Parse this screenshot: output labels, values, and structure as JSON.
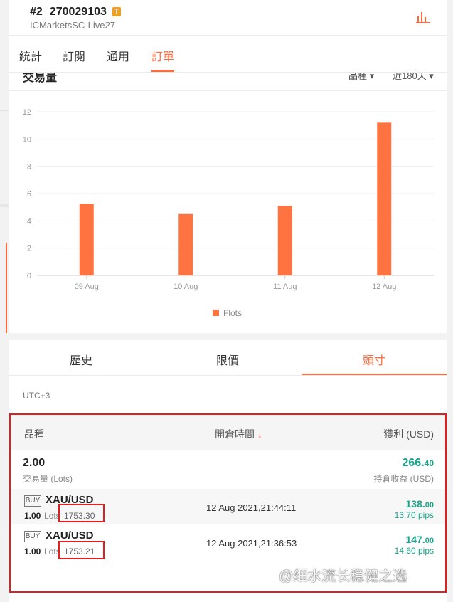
{
  "header": {
    "account_index": "#2",
    "account_number": "270029103",
    "badge": "T",
    "server": "ICMarketsSC-Live27",
    "stats_icon": "bar-chart-icon"
  },
  "tabs": [
    {
      "label": "統計"
    },
    {
      "label": "訂閱"
    },
    {
      "label": "通用"
    },
    {
      "label": "訂單"
    }
  ],
  "active_tab": "訂單",
  "chart_section": {
    "title": "交易量",
    "symbol_filter": "品種 ▾",
    "period_filter": "近180天 ▾"
  },
  "chart_data": {
    "type": "bar",
    "categories": [
      "09 Aug",
      "10 Aug",
      "11 Aug",
      "12 Aug"
    ],
    "series": [
      {
        "name": "Flots",
        "values": [
          5.25,
          4.5,
          5.1,
          11.2
        ]
      }
    ],
    "ylim": [
      0,
      12
    ],
    "yticks": [
      0,
      2,
      4,
      6,
      8,
      10,
      12
    ],
    "grid": true,
    "legend": "bottom",
    "bar_color": "#ff7340"
  },
  "subtabs": [
    {
      "label": "歷史"
    },
    {
      "label": "限價"
    },
    {
      "label": "頭寸"
    }
  ],
  "active_subtab": "頭寸",
  "timezone": "UTC+3",
  "table": {
    "col_symbol": "品種",
    "col_time": "開倉時間",
    "sort_arrow": "↓",
    "col_profit": "獲利 (USD)",
    "summary": {
      "volume": "2.00",
      "volume_label": "交易量 (Lots)",
      "profit_int": "266.",
      "profit_dec": "40",
      "profit_label": "持倉收益 (USD)"
    },
    "rows": [
      {
        "side": "BUY",
        "symbol": "XAU/USD",
        "lots": "1.00",
        "lots_label": "Lots",
        "open_price": "1753.30",
        "open_time": "12 Aug 2021,21:44:11",
        "profit_int": "138.",
        "profit_dec": "00",
        "pips": "13.70 pips"
      },
      {
        "side": "BUY",
        "symbol": "XAU/USD",
        "lots": "1.00",
        "lots_label": "Lots",
        "open_price": "1753.21",
        "open_time": "12 Aug 2021,21:36:53",
        "profit_int": "147.",
        "profit_dec": "00",
        "pips": "14.60 pips"
      }
    ]
  },
  "watermark": "@细水流长稳健之选",
  "colors": {
    "accent": "#ff6b3d",
    "profit": "#1aa58b",
    "highlight": "#e02020"
  }
}
